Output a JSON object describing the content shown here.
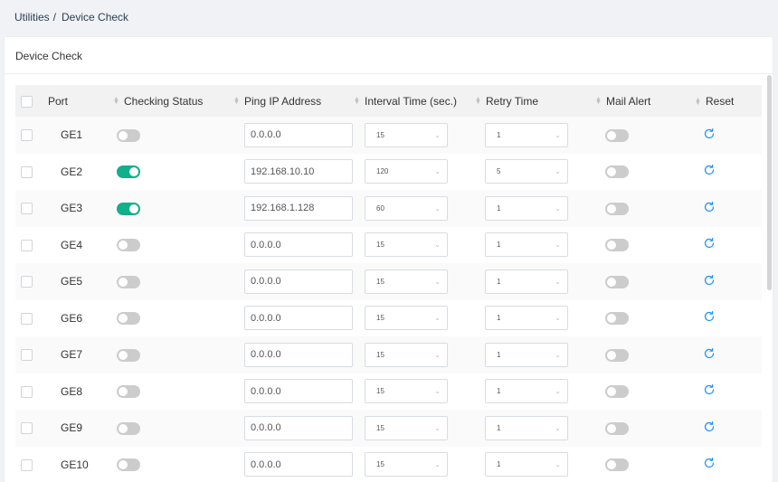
{
  "breadcrumb": {
    "parent": "Utilities",
    "separator": "/",
    "current": "Device Check"
  },
  "panel": {
    "title": "Device Check"
  },
  "table": {
    "headers": {
      "port": "Port",
      "checking_status": "Checking Status",
      "ping_ip": "Ping IP Address",
      "interval": "Interval Time (sec.)",
      "retry": "Retry Time",
      "mail_alert": "Mail Alert",
      "reset": "Reset"
    },
    "rows": [
      {
        "port": "GE1",
        "checking": false,
        "ip": "0.0.0.0",
        "interval": "15",
        "retry": "1",
        "mail": false
      },
      {
        "port": "GE2",
        "checking": true,
        "ip": "192.168.10.10",
        "interval": "120",
        "retry": "5",
        "mail": false
      },
      {
        "port": "GE3",
        "checking": true,
        "ip": "192.168.1.128",
        "interval": "60",
        "retry": "1",
        "mail": false
      },
      {
        "port": "GE4",
        "checking": false,
        "ip": "0.0.0.0",
        "interval": "15",
        "retry": "1",
        "mail": false
      },
      {
        "port": "GE5",
        "checking": false,
        "ip": "0.0.0.0",
        "interval": "15",
        "retry": "1",
        "mail": false
      },
      {
        "port": "GE6",
        "checking": false,
        "ip": "0.0.0.0",
        "interval": "15",
        "retry": "1",
        "mail": false
      },
      {
        "port": "GE7",
        "checking": false,
        "ip": "0.0.0.0",
        "interval": "15",
        "retry": "1",
        "mail": false
      },
      {
        "port": "GE8",
        "checking": false,
        "ip": "0.0.0.0",
        "interval": "15",
        "retry": "1",
        "mail": false
      },
      {
        "port": "GE9",
        "checking": false,
        "ip": "0.0.0.0",
        "interval": "15",
        "retry": "1",
        "mail": false
      },
      {
        "port": "GE10",
        "checking": false,
        "ip": "0.0.0.0",
        "interval": "15",
        "retry": "1",
        "mail": false
      }
    ]
  },
  "icons": {
    "sort": "sort-icon",
    "select": "chevron-down-icon",
    "reset": "refresh-icon"
  },
  "colors": {
    "toggle_on": "#11b08a",
    "toggle_off": "#cccccc",
    "reset_icon": "#1890ff"
  }
}
